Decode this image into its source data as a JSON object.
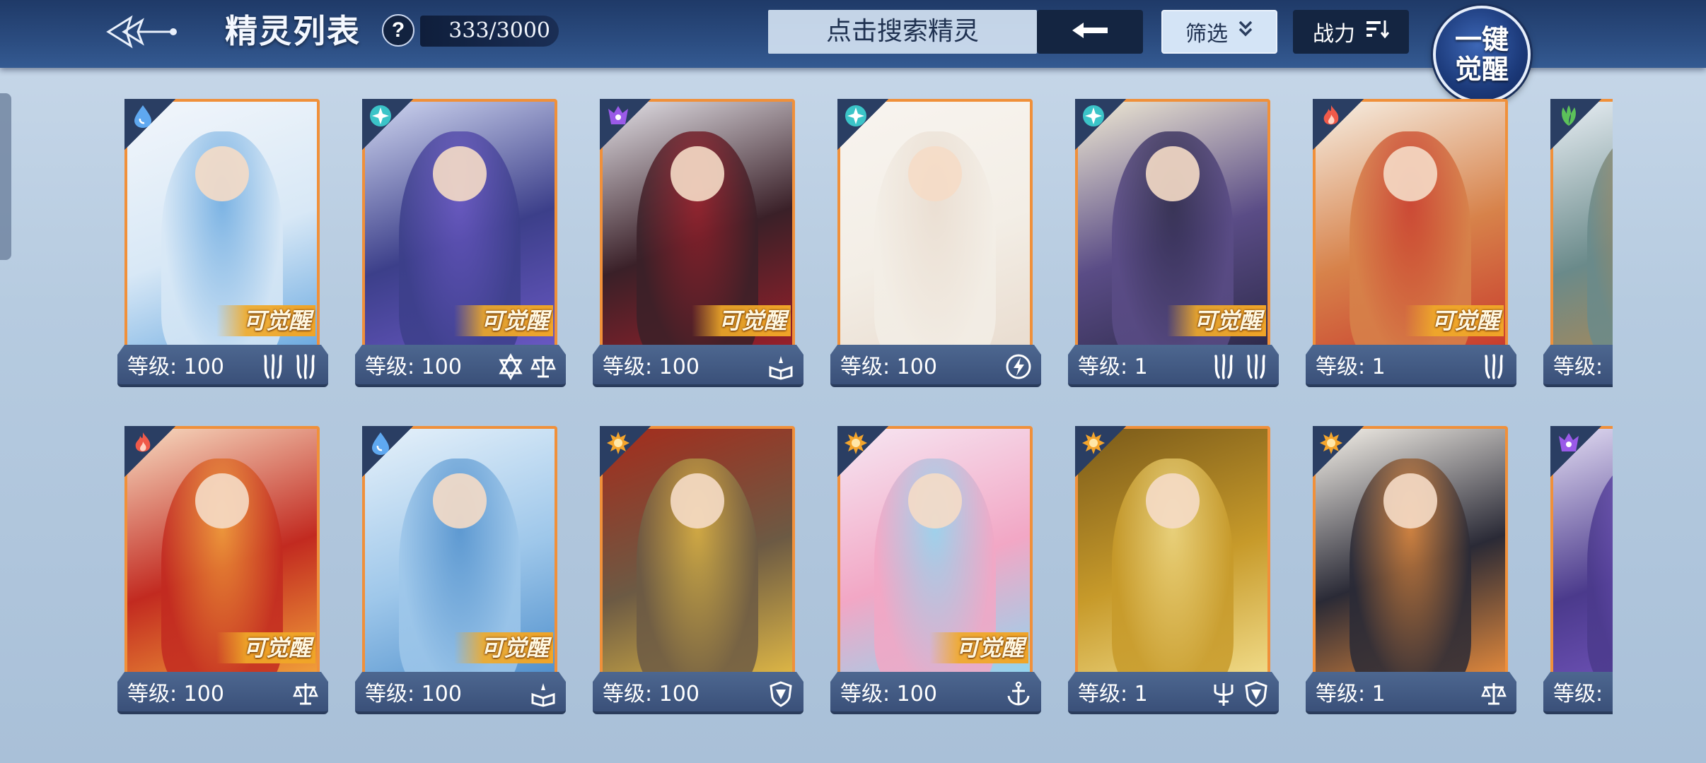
{
  "header": {
    "title": "精灵列表",
    "help_label": "?",
    "count": "333/3000",
    "search_placeholder": "点击搜索精灵",
    "filter_label": "筛选",
    "sort_label": "战力",
    "awaken_all_line1": "一键",
    "awaken_all_line2": "觉醒"
  },
  "icons": {
    "back": "ornate-back-icon",
    "search_submit": "arrow-left-icon",
    "filter": "double-chevron-down-icon",
    "sort": "sort-lines-icon"
  },
  "colors": {
    "card_border": "#f0903a",
    "header_bg": "#2b4c80",
    "level_bar": "#3a5079"
  },
  "cards": [
    {
      "element": "water",
      "level": "等级: 100",
      "awakenable": "可觉醒",
      "roles": [
        "claw",
        "claw"
      ],
      "palette": [
        "#d8e8f6",
        "#6aa9e0",
        "#f2f6fb"
      ]
    },
    {
      "element": "light-star",
      "level": "等级: 100",
      "awakenable": "可觉醒",
      "roles": [
        "hexagram",
        "scales"
      ],
      "palette": [
        "#3c3f8a",
        "#6a58c4",
        "#cfd6f0"
      ]
    },
    {
      "element": "dark",
      "level": "等级: 100",
      "awakenable": "可觉醒",
      "roles": [
        "book"
      ],
      "palette": [
        "#3a2028",
        "#9b1f2a",
        "#e2e0e6"
      ]
    },
    {
      "element": "light-star",
      "level": "等级: 100",
      "awakenable": "",
      "roles": [
        "lightning"
      ],
      "palette": [
        "#f3eee6",
        "#e9dccf",
        "#f8f4ef"
      ]
    },
    {
      "element": "light-star",
      "level": "等级: 1",
      "awakenable": "可觉醒",
      "roles": [
        "claw",
        "claw"
      ],
      "palette": [
        "#5a4c86",
        "#2d2a4a",
        "#f0ead4"
      ]
    },
    {
      "element": "fire",
      "level": "等级: 1",
      "awakenable": "可觉醒",
      "roles": [
        "claw"
      ],
      "palette": [
        "#d7824a",
        "#c83a2c",
        "#f6efe4"
      ]
    },
    {
      "element": "grass",
      "level": "等级: ",
      "awakenable": "",
      "roles": [],
      "palette": [
        "#6a8a8a",
        "#b8884c",
        "#e8eef4"
      ]
    },
    {
      "element": "fire",
      "level": "等级: 100",
      "awakenable": "可觉醒",
      "roles": [
        "scales"
      ],
      "palette": [
        "#c22a20",
        "#f2a23a",
        "#f7dcc2"
      ]
    },
    {
      "element": "water",
      "level": "等级: 100",
      "awakenable": "可觉醒",
      "roles": [
        "book"
      ],
      "palette": [
        "#9ec7ea",
        "#4f8fcc",
        "#e6f1fa"
      ]
    },
    {
      "element": "sun",
      "level": "等级: 100",
      "awakenable": "",
      "roles": [
        "shield"
      ],
      "palette": [
        "#6c5a44",
        "#e0b845",
        "#a52c1c"
      ]
    },
    {
      "element": "sun",
      "level": "等级: 100",
      "awakenable": "可觉醒",
      "roles": [
        "anchor"
      ],
      "palette": [
        "#f2a7c5",
        "#8fd6f0",
        "#f6e6f2"
      ]
    },
    {
      "element": "sun",
      "level": "等级: 1",
      "awakenable": "",
      "roles": [
        "trident",
        "shield"
      ],
      "palette": [
        "#c79a2a",
        "#f1dc8a",
        "#7a5a1a"
      ]
    },
    {
      "element": "sun",
      "level": "等级: 1",
      "awakenable": "",
      "roles": [
        "scales"
      ],
      "palette": [
        "#2a2a36",
        "#e48a3c",
        "#f6f2ea"
      ]
    },
    {
      "element": "dark",
      "level": "等级: ",
      "awakenable": "",
      "roles": [],
      "palette": [
        "#4b3a8c",
        "#7a5ac6",
        "#e2dcf2"
      ]
    }
  ]
}
